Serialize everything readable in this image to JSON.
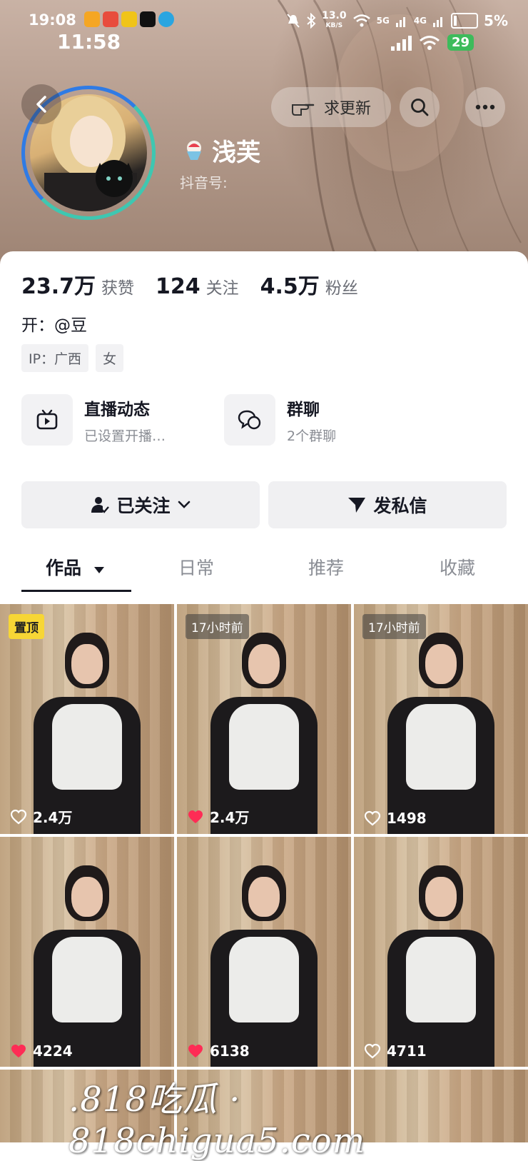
{
  "status_bar": {
    "time_small": "19:08",
    "time": "11:58",
    "net_speed": "13.0",
    "net_unit": "KB/S",
    "signal_1": "5G",
    "signal_2": "4G",
    "battery": "5%",
    "badge": "29"
  },
  "header": {
    "request_update_label": "求更新",
    "nickname": "浅芙",
    "douyin_id_label": "抖音号:"
  },
  "stats": [
    {
      "value": "23.7万",
      "label": "获赞"
    },
    {
      "value": "124",
      "label": "关注"
    },
    {
      "value": "4.5万",
      "label": "粉丝"
    }
  ],
  "bio": "开：@豆",
  "tags": [
    "IP：广西",
    "女"
  ],
  "features": [
    {
      "title": "直播动态",
      "subtitle": "已设置开播…",
      "icon": "tv-icon"
    },
    {
      "title": "群聊",
      "subtitle": "2个群聊",
      "icon": "chat-bubbles-icon"
    }
  ],
  "actions": {
    "follow_label": "已关注",
    "message_label": "发私信"
  },
  "tabs": [
    "作品",
    "日常",
    "推荐",
    "收藏"
  ],
  "videos": [
    {
      "badge": "置顶",
      "badge_type": "pin",
      "likes": "2.4万",
      "liked": false
    },
    {
      "badge": "17小时前",
      "badge_type": "time",
      "likes": "2.4万",
      "liked": true
    },
    {
      "badge": "17小时前",
      "badge_type": "time",
      "likes": "1498",
      "liked": false
    },
    {
      "badge": "",
      "badge_type": "none",
      "likes": "4224",
      "liked": true
    },
    {
      "badge": "",
      "badge_type": "none",
      "likes": "6138",
      "liked": true
    },
    {
      "badge": "",
      "badge_type": "none",
      "likes": "4711",
      "liked": false
    }
  ],
  "watermark": ".818吃瓜 · 818chigua5.com",
  "colors": {
    "liked_heart": "#fe2c55",
    "pin_badge": "#f7d635",
    "ring_blue": "#2f7be5",
    "ring_green": "#3ec7b1"
  }
}
